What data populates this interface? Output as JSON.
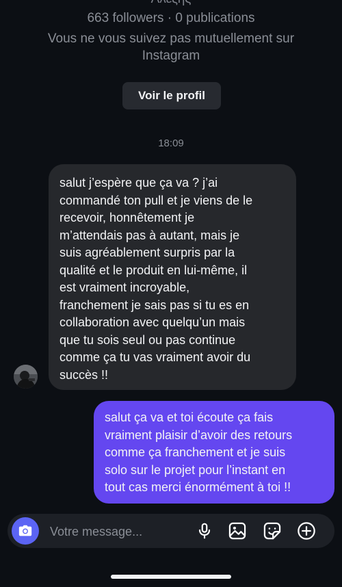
{
  "header": {
    "name": "Αλεξης",
    "followers": "663 followers · 0 publications",
    "mutual_notice": "Vous ne vous suivez pas mutuellement sur Instagram",
    "view_profile_label": "Voir le profil"
  },
  "conversation": {
    "timestamp": "18:09",
    "messages": [
      {
        "direction": "incoming",
        "lines": [
          "salut j’espère que ça va ? j’ai",
          "commandé ton pull et je viens de le",
          "recevoir, honnêtement je",
          "m’attendais pas à autant, mais je",
          "suis agréablement surpris par la",
          "qualité et le produit en lui-même, il",
          "est vraiment incroyable,",
          "franchement je sais pas si tu es en",
          "collaboration avec quelqu’un mais",
          "que tu sois seul ou pas continue",
          "comme ça tu vas vraiment avoir du",
          "succès !!"
        ]
      },
      {
        "direction": "outgoing",
        "lines": [
          "salut ça va et toi écoute ça fais",
          "vraiment plaisir d’avoir des retours",
          "comme ça franchement et je suis",
          "solo sur le projet pour l’instant en",
          "tout cas merci énormément à toi !!"
        ]
      }
    ]
  },
  "composer": {
    "placeholder": "Votre message...",
    "icons": [
      "camera-icon",
      "microphone-icon",
      "gallery-icon",
      "sticker-icon",
      "plus-icon"
    ]
  },
  "colors": {
    "background": "#0c0f14",
    "incoming_bubble": "#26282c",
    "outgoing_bubble": "#6447f0",
    "camera_button": "#5b64f4"
  }
}
